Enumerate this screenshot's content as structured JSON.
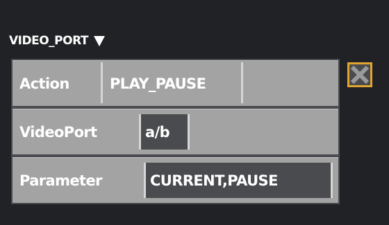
{
  "section": {
    "title": "VIDEO_PORT"
  },
  "rows": [
    {
      "label": "Action",
      "value": "PLAY_PAUSE"
    },
    {
      "label": "VideoPort",
      "value": "a/b"
    },
    {
      "label": "Parameter",
      "value": "CURRENT,PAUSE"
    }
  ],
  "icons": {
    "dropdown": "triangle-down-icon",
    "close": "close-icon"
  },
  "colors": {
    "background": "#212225",
    "panel": "#4a4b4e",
    "row": "#a3a3a3",
    "accent": "#e2a530"
  }
}
